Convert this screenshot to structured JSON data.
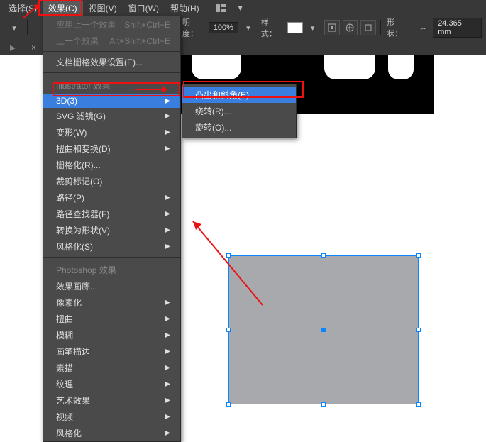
{
  "menubar": {
    "items": [
      {
        "label": "选择(S)"
      },
      {
        "label": "效果(C)"
      },
      {
        "label": "视图(V)"
      },
      {
        "label": "窗口(W)"
      },
      {
        "label": "帮助(H)"
      }
    ]
  },
  "toolbar": {
    "opacity_label": "明度：",
    "opacity_value": "100%",
    "style_label": "样式：",
    "shape_label": "形状：",
    "shape_value": "24.365 mm"
  },
  "doc_tab": {
    "title": "",
    "close": "×"
  },
  "menu": {
    "apply_last": {
      "label": "应用上一个效果",
      "shortcut": "Shift+Ctrl+E"
    },
    "last_effect": {
      "label": "上一个效果",
      "shortcut": "Alt+Shift+Ctrl+E"
    },
    "doc_raster": "文档栅格效果设置(E)...",
    "group_ai": "Illustrator 效果",
    "ai_items": [
      {
        "label": "3D(3)"
      },
      {
        "label": "SVG 滤镜(G)"
      },
      {
        "label": "变形(W)"
      },
      {
        "label": "扭曲和变换(D)"
      },
      {
        "label": "栅格化(R)..."
      },
      {
        "label": "裁剪标记(O)"
      },
      {
        "label": "路径(P)"
      },
      {
        "label": "路径查找器(F)"
      },
      {
        "label": "转换为形状(V)"
      },
      {
        "label": "风格化(S)"
      }
    ],
    "group_ps": "Photoshop 效果",
    "ps_items": [
      {
        "label": "效果画廊..."
      },
      {
        "label": "像素化"
      },
      {
        "label": "扭曲"
      },
      {
        "label": "模糊"
      },
      {
        "label": "画笔描边"
      },
      {
        "label": "素描"
      },
      {
        "label": "纹理"
      },
      {
        "label": "艺术效果"
      },
      {
        "label": "视频"
      },
      {
        "label": "风格化"
      }
    ]
  },
  "submenu": {
    "items": [
      {
        "label": "凸出和斜角(E)..."
      },
      {
        "label": "绕转(R)..."
      },
      {
        "label": "旋转(O)..."
      }
    ]
  }
}
